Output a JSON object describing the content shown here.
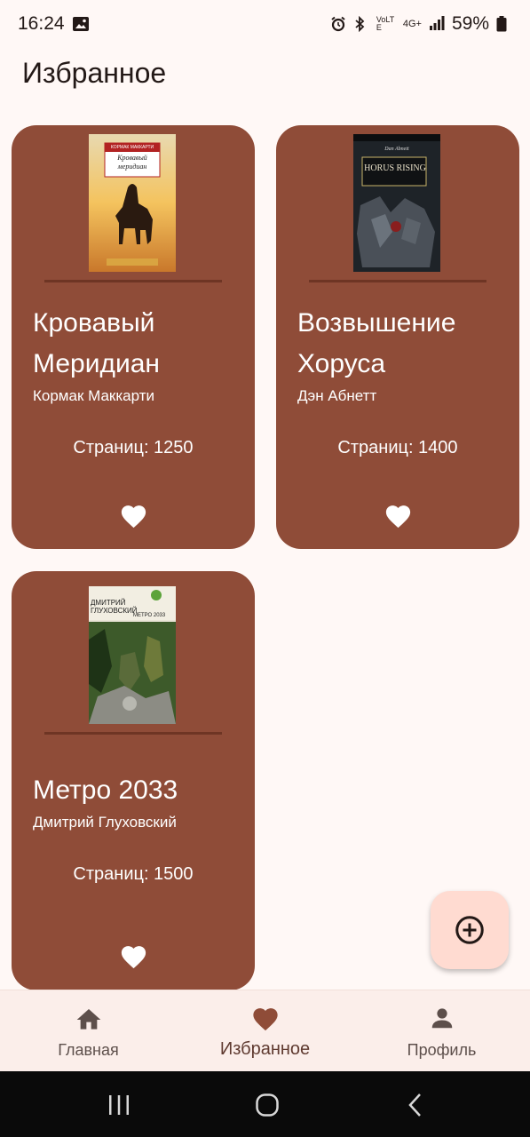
{
  "status_bar": {
    "time": "16:24",
    "network": "4G+",
    "lte": "VoLTE",
    "battery": "59%"
  },
  "page": {
    "title": "Избранное"
  },
  "books": [
    {
      "title": "Кровавый Меридиан",
      "author": "Кормак Маккарти",
      "pages": "Страниц: 1250",
      "cover_top_text": "КОРМАК МАККАРТИ",
      "cover_title_text": "Кровавый меридиан",
      "favorite": true
    },
    {
      "title": "Возвышение Хоруса",
      "author": "Дэн Абнетт",
      "pages": "Страниц: 1400",
      "cover_top_text": "Dan Abnett",
      "cover_title_text": "HORUS RISING",
      "favorite": true
    },
    {
      "title": "Метро 2033",
      "author": "Дмитрий Глуховский",
      "pages": "Страниц: 1500",
      "cover_top_text": "ДМИТРИЙ ГЛУХОВСКИЙ",
      "cover_title_text": "МЕТРО 2033",
      "favorite": true
    }
  ],
  "fab": {
    "icon": "add-circle-icon"
  },
  "nav": {
    "items": [
      {
        "label": "Главная",
        "icon": "home-icon",
        "active": false
      },
      {
        "label": "Избранное",
        "icon": "heart-icon",
        "active": true
      },
      {
        "label": "Профиль",
        "icon": "person-icon",
        "active": false
      }
    ]
  },
  "colors": {
    "background": "#FFF8F6",
    "card": "#8F4C38",
    "fab": "#FFDBD1",
    "nav_bar": "#FBEEEA",
    "active_icon": "#8F4C38"
  }
}
